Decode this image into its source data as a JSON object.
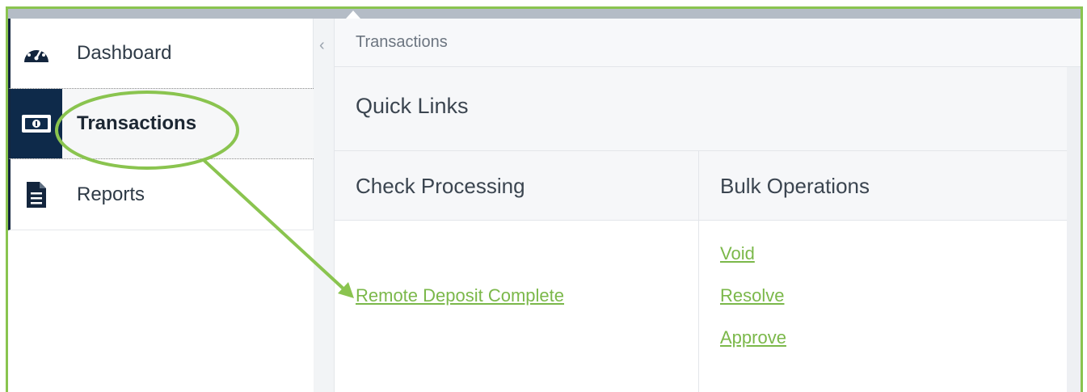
{
  "sidebar": {
    "items": [
      {
        "label": "Dashboard",
        "icon": "speedometer-icon"
      },
      {
        "label": "Transactions",
        "icon": "banknote-icon"
      },
      {
        "label": "Reports",
        "icon": "document-icon"
      }
    ]
  },
  "breadcrumb": {
    "current": "Transactions"
  },
  "panel": {
    "title": "Quick Links",
    "columns": [
      {
        "header": "Check Processing",
        "links": [
          "Remote Deposit Complete"
        ]
      },
      {
        "header": "Bulk Operations",
        "links": [
          "Void",
          "Resolve",
          "Approve"
        ]
      }
    ]
  },
  "colors": {
    "accent_green": "#8ac44f",
    "link_green": "#7bb84a",
    "nav_active": "#0e2a4a",
    "text": "#3b4550"
  }
}
